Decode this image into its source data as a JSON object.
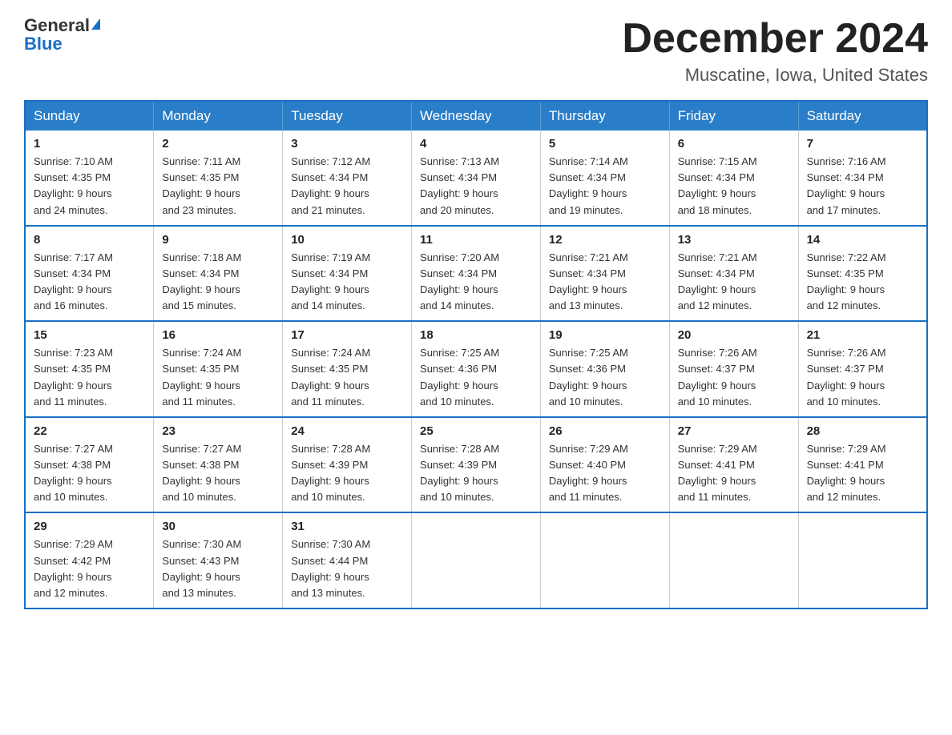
{
  "header": {
    "logo_line1": "General",
    "logo_line2": "Blue",
    "month_title": "December 2024",
    "location": "Muscatine, Iowa, United States"
  },
  "weekdays": [
    "Sunday",
    "Monday",
    "Tuesday",
    "Wednesday",
    "Thursday",
    "Friday",
    "Saturday"
  ],
  "weeks": [
    [
      {
        "day": "1",
        "sunrise": "7:10 AM",
        "sunset": "4:35 PM",
        "daylight": "9 hours and 24 minutes."
      },
      {
        "day": "2",
        "sunrise": "7:11 AM",
        "sunset": "4:35 PM",
        "daylight": "9 hours and 23 minutes."
      },
      {
        "day": "3",
        "sunrise": "7:12 AM",
        "sunset": "4:34 PM",
        "daylight": "9 hours and 21 minutes."
      },
      {
        "day": "4",
        "sunrise": "7:13 AM",
        "sunset": "4:34 PM",
        "daylight": "9 hours and 20 minutes."
      },
      {
        "day": "5",
        "sunrise": "7:14 AM",
        "sunset": "4:34 PM",
        "daylight": "9 hours and 19 minutes."
      },
      {
        "day": "6",
        "sunrise": "7:15 AM",
        "sunset": "4:34 PM",
        "daylight": "9 hours and 18 minutes."
      },
      {
        "day": "7",
        "sunrise": "7:16 AM",
        "sunset": "4:34 PM",
        "daylight": "9 hours and 17 minutes."
      }
    ],
    [
      {
        "day": "8",
        "sunrise": "7:17 AM",
        "sunset": "4:34 PM",
        "daylight": "9 hours and 16 minutes."
      },
      {
        "day": "9",
        "sunrise": "7:18 AM",
        "sunset": "4:34 PM",
        "daylight": "9 hours and 15 minutes."
      },
      {
        "day": "10",
        "sunrise": "7:19 AM",
        "sunset": "4:34 PM",
        "daylight": "9 hours and 14 minutes."
      },
      {
        "day": "11",
        "sunrise": "7:20 AM",
        "sunset": "4:34 PM",
        "daylight": "9 hours and 14 minutes."
      },
      {
        "day": "12",
        "sunrise": "7:21 AM",
        "sunset": "4:34 PM",
        "daylight": "9 hours and 13 minutes."
      },
      {
        "day": "13",
        "sunrise": "7:21 AM",
        "sunset": "4:34 PM",
        "daylight": "9 hours and 12 minutes."
      },
      {
        "day": "14",
        "sunrise": "7:22 AM",
        "sunset": "4:35 PM",
        "daylight": "9 hours and 12 minutes."
      }
    ],
    [
      {
        "day": "15",
        "sunrise": "7:23 AM",
        "sunset": "4:35 PM",
        "daylight": "9 hours and 11 minutes."
      },
      {
        "day": "16",
        "sunrise": "7:24 AM",
        "sunset": "4:35 PM",
        "daylight": "9 hours and 11 minutes."
      },
      {
        "day": "17",
        "sunrise": "7:24 AM",
        "sunset": "4:35 PM",
        "daylight": "9 hours and 11 minutes."
      },
      {
        "day": "18",
        "sunrise": "7:25 AM",
        "sunset": "4:36 PM",
        "daylight": "9 hours and 10 minutes."
      },
      {
        "day": "19",
        "sunrise": "7:25 AM",
        "sunset": "4:36 PM",
        "daylight": "9 hours and 10 minutes."
      },
      {
        "day": "20",
        "sunrise": "7:26 AM",
        "sunset": "4:37 PM",
        "daylight": "9 hours and 10 minutes."
      },
      {
        "day": "21",
        "sunrise": "7:26 AM",
        "sunset": "4:37 PM",
        "daylight": "9 hours and 10 minutes."
      }
    ],
    [
      {
        "day": "22",
        "sunrise": "7:27 AM",
        "sunset": "4:38 PM",
        "daylight": "9 hours and 10 minutes."
      },
      {
        "day": "23",
        "sunrise": "7:27 AM",
        "sunset": "4:38 PM",
        "daylight": "9 hours and 10 minutes."
      },
      {
        "day": "24",
        "sunrise": "7:28 AM",
        "sunset": "4:39 PM",
        "daylight": "9 hours and 10 minutes."
      },
      {
        "day": "25",
        "sunrise": "7:28 AM",
        "sunset": "4:39 PM",
        "daylight": "9 hours and 10 minutes."
      },
      {
        "day": "26",
        "sunrise": "7:29 AM",
        "sunset": "4:40 PM",
        "daylight": "9 hours and 11 minutes."
      },
      {
        "day": "27",
        "sunrise": "7:29 AM",
        "sunset": "4:41 PM",
        "daylight": "9 hours and 11 minutes."
      },
      {
        "day": "28",
        "sunrise": "7:29 AM",
        "sunset": "4:41 PM",
        "daylight": "9 hours and 12 minutes."
      }
    ],
    [
      {
        "day": "29",
        "sunrise": "7:29 AM",
        "sunset": "4:42 PM",
        "daylight": "9 hours and 12 minutes."
      },
      {
        "day": "30",
        "sunrise": "7:30 AM",
        "sunset": "4:43 PM",
        "daylight": "9 hours and 13 minutes."
      },
      {
        "day": "31",
        "sunrise": "7:30 AM",
        "sunset": "4:44 PM",
        "daylight": "9 hours and 13 minutes."
      },
      null,
      null,
      null,
      null
    ]
  ],
  "labels": {
    "sunrise": "Sunrise:",
    "sunset": "Sunset:",
    "daylight": "Daylight:"
  }
}
